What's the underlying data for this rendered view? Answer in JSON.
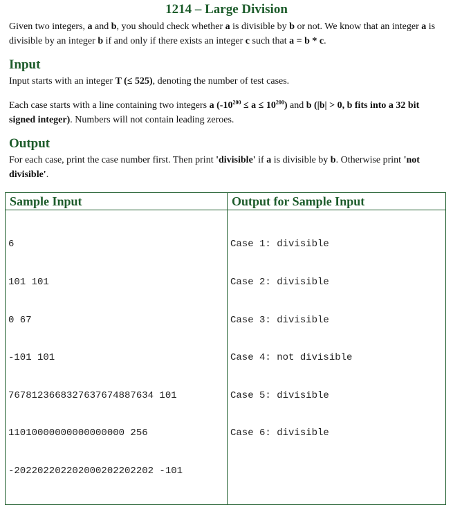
{
  "title": "1214 – Large Division",
  "intro": {
    "p1": "Given two integers, ",
    "a": "a",
    "p2": " and ",
    "b": "b",
    "p3": ", you should check whether ",
    "a2": "a",
    "p4": " is divisible by ",
    "b2": "b",
    "p5": " or not. We know that an integer ",
    "a3": "a",
    "p6": " is divisible by an integer ",
    "b3": "b",
    "p7": " if and only if there exists an integer ",
    "c": "c",
    "p8": " such that ",
    "eq": "a = b * c",
    "p9": "."
  },
  "input_heading": "Input",
  "input": {
    "t_pre": "Input starts with an integer ",
    "t_bold": "T (≤ 525)",
    "t_post": ", denoting the number of test cases.",
    "case_pre": "Each case starts with a line containing two integers ",
    "a_bold_1": "a (-10",
    "exp1": "200",
    "a_bold_2": " ≤ a ≤ 10",
    "exp2": "200",
    "a_bold_3": ")",
    "and": " and ",
    "b_bold": "b (|b| > 0, b fits into a 32 bit signed integer)",
    "case_post": ". Numbers will not contain leading zeroes."
  },
  "output_heading": "Output",
  "output": {
    "p1": "For each case, print the case number first. Then print ",
    "div": "'divisible'",
    "p2": " if ",
    "a": "a",
    "p3": " is divisible by ",
    "b": "b",
    "p4": ". Otherwise print ",
    "notdiv": "'not divisible'",
    "p5": "."
  },
  "sample": {
    "input_header": "Sample Input",
    "output_header": "Output for Sample Input",
    "input_lines": [
      "6",
      "101 101",
      "0 67",
      "-101 101",
      "7678123668327637674887634 101",
      "11010000000000000000 256",
      "-202202202202000202202202 -101"
    ],
    "output_lines": [
      "Case 1: divisible",
      "Case 2: divisible",
      "Case 3: divisible",
      "Case 4: not divisible",
      "Case 5: divisible",
      "Case 6: divisible"
    ]
  }
}
